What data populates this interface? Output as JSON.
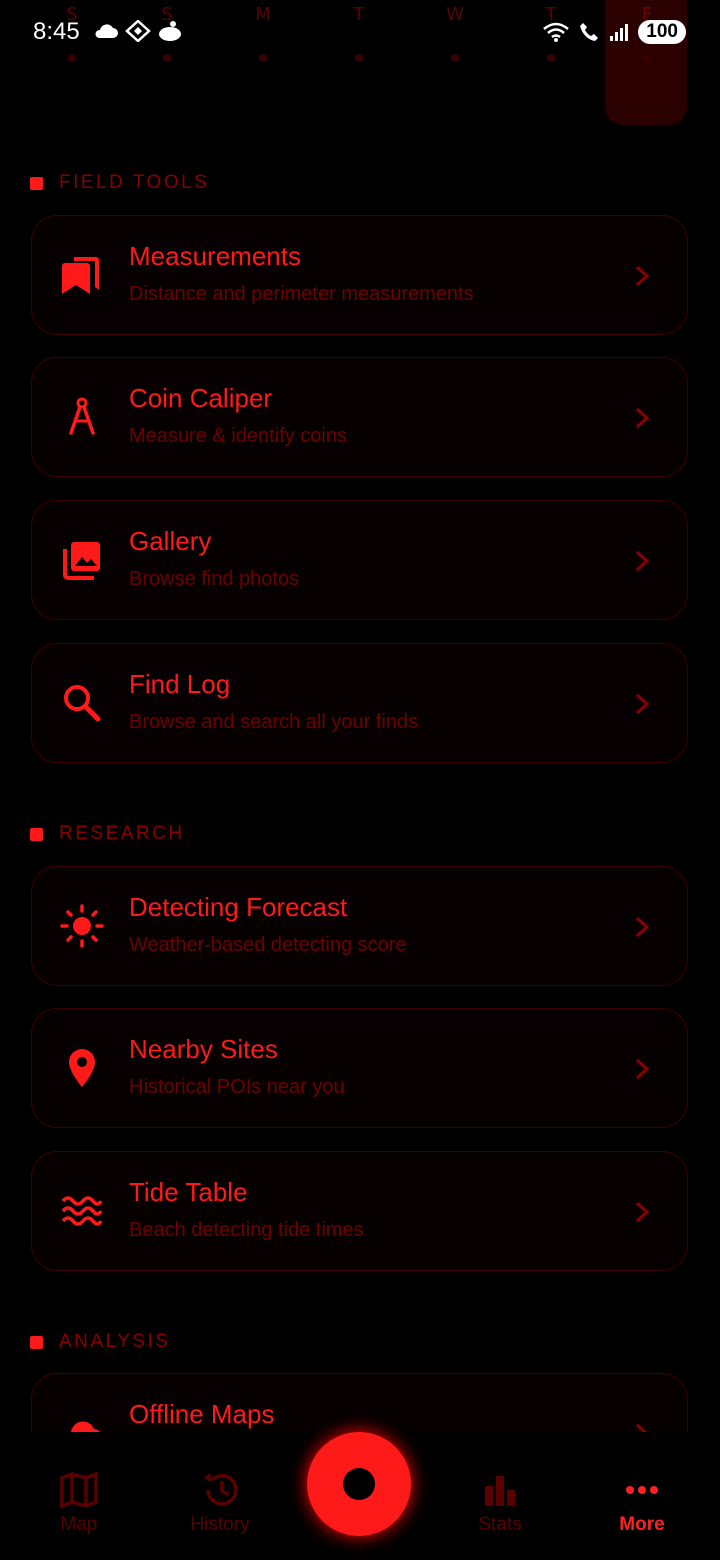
{
  "status": {
    "time": "8:45",
    "battery": "100"
  },
  "calendar": {
    "days": [
      "S",
      "S",
      "M",
      "T",
      "W",
      "T",
      "F"
    ]
  },
  "sections": [
    {
      "title": "FIELD TOOLS",
      "items": [
        {
          "title": "Measurements",
          "subtitle": "Distance and perimeter measurements",
          "icon": "bookmarks-icon"
        },
        {
          "title": "Coin Caliper",
          "subtitle": "Measure & identify coins",
          "icon": "compass-icon"
        },
        {
          "title": "Gallery",
          "subtitle": "Browse find photos",
          "icon": "photo-library-icon"
        },
        {
          "title": "Find Log",
          "subtitle": "Browse and search all your finds",
          "icon": "search-icon"
        }
      ]
    },
    {
      "title": "RESEARCH",
      "items": [
        {
          "title": "Detecting Forecast",
          "subtitle": "Weather-based detecting score",
          "icon": "sun-icon"
        },
        {
          "title": "Nearby Sites",
          "subtitle": "Historical POIs near you",
          "icon": "location-pin-icon"
        },
        {
          "title": "Tide Table",
          "subtitle": "Beach detecting tide times",
          "icon": "waves-icon"
        }
      ]
    },
    {
      "title": "ANALYSIS",
      "items": [
        {
          "title": "Offline Maps",
          "subtitle": "",
          "icon": "cloud-icon"
        }
      ]
    }
  ],
  "nav": {
    "map": "Map",
    "history": "History",
    "stats": "Stats",
    "more": "More"
  },
  "colors": {
    "accent": "#ff1a1a",
    "background": "#000000",
    "muted": "#6e0000"
  }
}
